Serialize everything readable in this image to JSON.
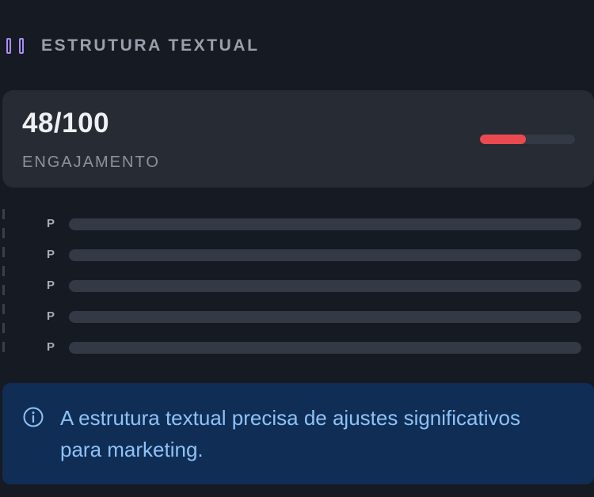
{
  "header": {
    "icon": "columns-icon",
    "title": "ESTRUTURA TEXTUAL",
    "accent_color": "#a98cf5"
  },
  "score": {
    "value": "48/100",
    "label": "ENGAJAMENTO",
    "progress_fraction": 0.48,
    "progress_color": "#ea4a4f"
  },
  "paragraphs": [
    {
      "label": "P"
    },
    {
      "label": "P"
    },
    {
      "label": "P"
    },
    {
      "label": "P"
    },
    {
      "label": "P"
    }
  ],
  "info": {
    "icon": "info-icon",
    "message": "A estrutura textual precisa de ajustes significativos para marketing."
  }
}
